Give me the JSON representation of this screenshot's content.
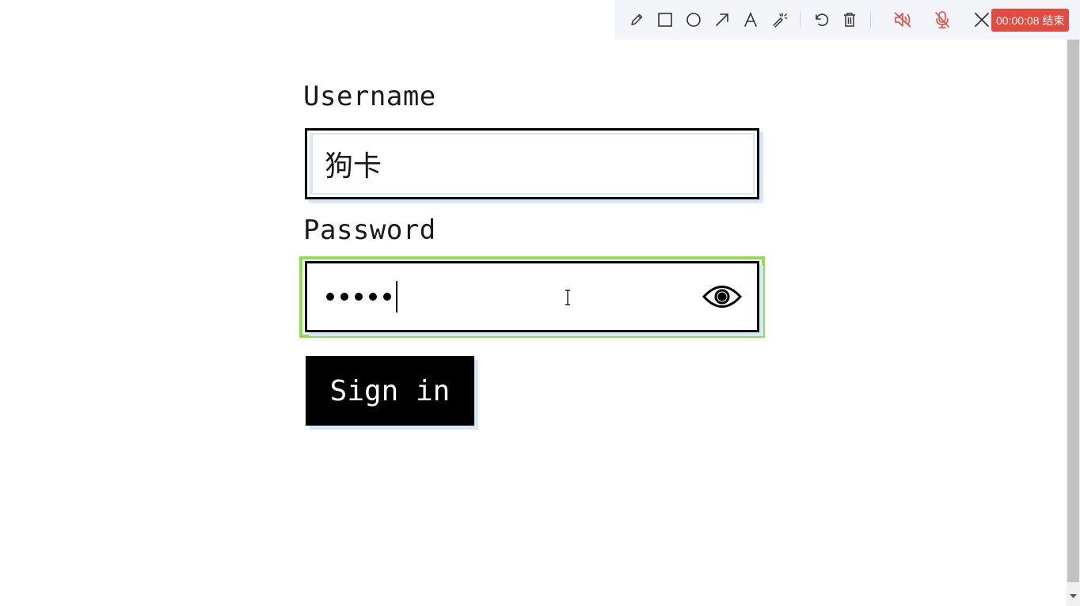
{
  "toolbar": {
    "tools": [
      {
        "name": "pencil-icon"
      },
      {
        "name": "rectangle-icon"
      },
      {
        "name": "circle-icon"
      },
      {
        "name": "arrow-icon"
      },
      {
        "name": "text-icon"
      },
      {
        "name": "magic-wand-icon"
      },
      {
        "name": "undo-icon"
      },
      {
        "name": "trash-icon"
      },
      {
        "name": "speaker-muted-icon"
      },
      {
        "name": "microphone-muted-icon"
      },
      {
        "name": "close-icon"
      }
    ],
    "recording_badge": "00:00:08 结束",
    "colors": {
      "background": "#f3f5fa",
      "icon": "#333333",
      "muted_icon": "#e34a40",
      "badge": "#e34a40"
    }
  },
  "form": {
    "username_label": "Username",
    "username_value": "狗卡",
    "password_label": "Password",
    "password_length": 5,
    "password_toggle_icon": "eye-icon",
    "submit_label": "Sign in",
    "colors": {
      "focus_ring": "#8ee04a",
      "button_bg": "#000000",
      "shadow": "#d6e6fb"
    }
  }
}
